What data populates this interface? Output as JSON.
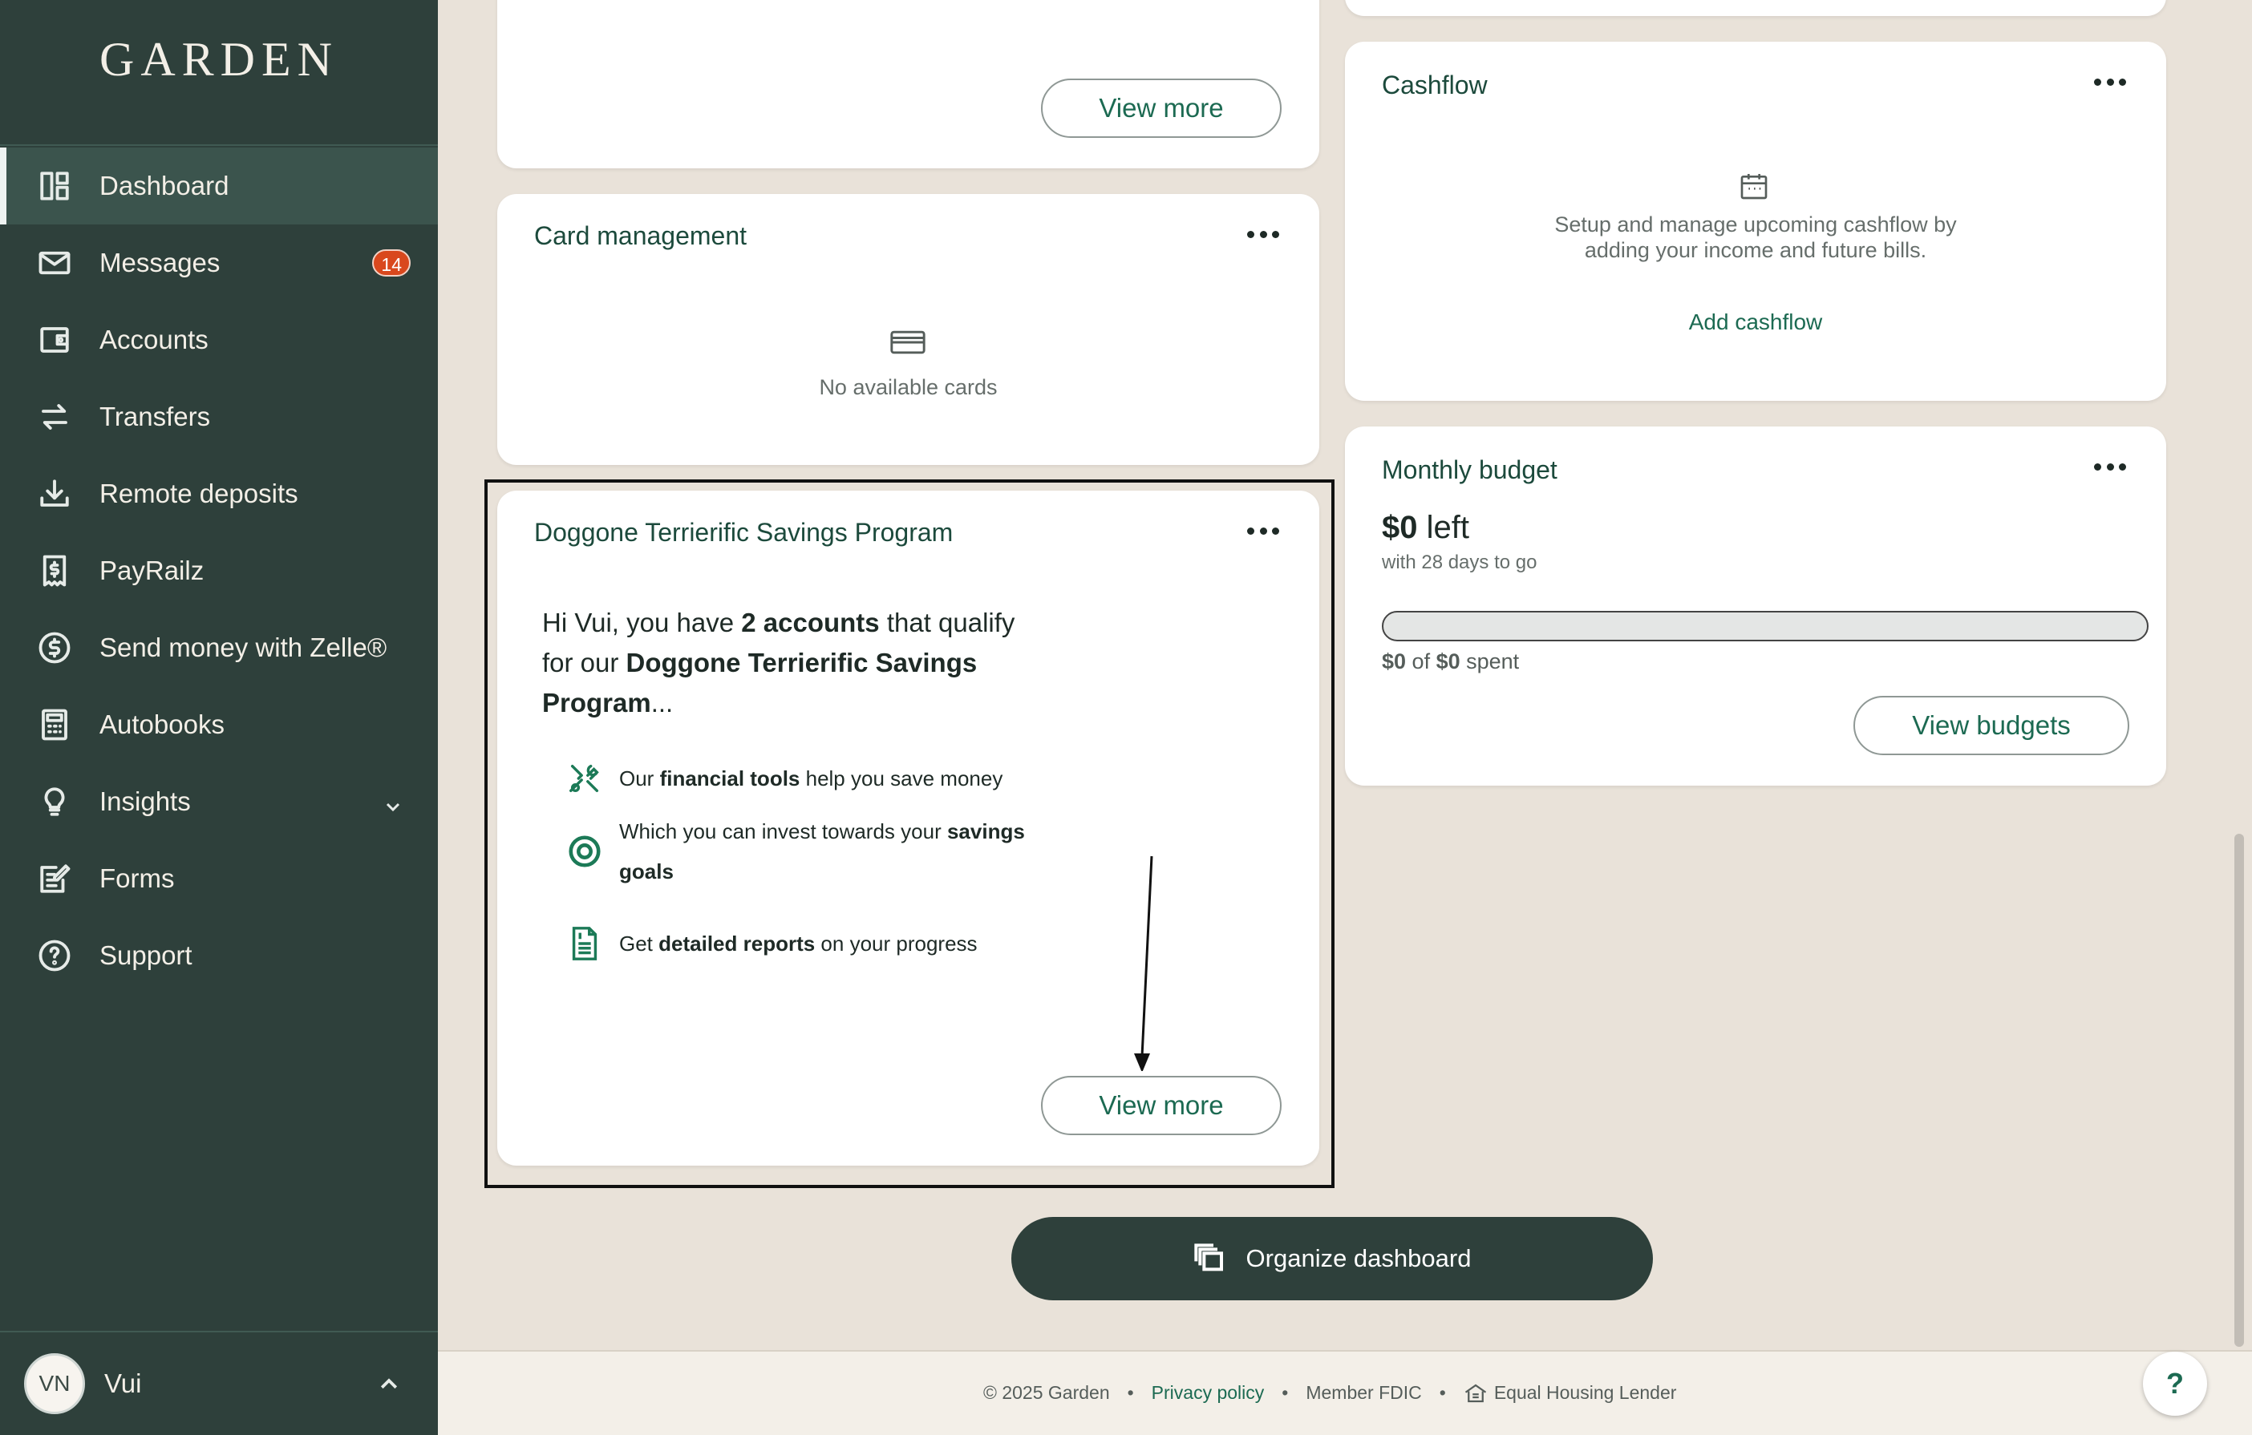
{
  "app": {
    "logo": "GARDEN"
  },
  "sidebar": {
    "items": [
      {
        "label": "Dashboard",
        "icon": "dashboard-icon",
        "active": true
      },
      {
        "label": "Messages",
        "icon": "envelope-icon",
        "badge": "14"
      },
      {
        "label": "Accounts",
        "icon": "wallet-icon"
      },
      {
        "label": "Transfers",
        "icon": "transfer-arrows-icon"
      },
      {
        "label": "Remote deposits",
        "icon": "download-icon"
      },
      {
        "label": "PayRailz",
        "icon": "dollar-receipt-icon"
      },
      {
        "label": "Send money with Zelle®",
        "icon": "dollar-circle-icon"
      },
      {
        "label": "Autobooks",
        "icon": "calculator-icon"
      },
      {
        "label": "Insights",
        "icon": "lightbulb-icon"
      },
      {
        "label": "Forms",
        "icon": "form-edit-icon"
      },
      {
        "label": "Support",
        "icon": "question-circle-icon"
      }
    ],
    "user": {
      "initials": "VN",
      "name": "Vui"
    }
  },
  "cards": {
    "top_left": {
      "button": "View more"
    },
    "card_management": {
      "title": "Card management",
      "empty_text": "No available cards"
    },
    "savings_program": {
      "title": "Doggone Terrierific Savings Program",
      "intro_1": "Hi Vui, you have ",
      "intro_bold_1": "2 accounts",
      "intro_2": " that qualify for our ",
      "intro_bold_2": "Doggone Terrierific Savings Program",
      "intro_3": "...",
      "features": [
        {
          "pre": "Our ",
          "bold": "financial tools",
          "post": " help you save money"
        },
        {
          "pre": "Which you can invest towards your ",
          "bold": "savings goals",
          "post": ""
        },
        {
          "pre": "Get ",
          "bold": "detailed reports",
          "post": " on your progress"
        }
      ],
      "button": "View more"
    },
    "cashflow": {
      "title": "Cashflow",
      "text": "Setup and manage upcoming cashflow by adding your income and future bills.",
      "link": "Add cashflow"
    },
    "monthly_budget": {
      "title": "Monthly budget",
      "amount": "$0",
      "amount_suffix": " left",
      "days": "with 28 days to go",
      "spent_amount": "$0",
      "spent_of": " of ",
      "spent_total": "$0",
      "spent_suffix": " spent",
      "progress_fraction": 0,
      "button": "View budgets"
    }
  },
  "organize_button": "Organize dashboard",
  "footer": {
    "copyright": "© 2025 Garden",
    "separator": "•",
    "privacy": "Privacy policy",
    "fdic": "Member FDIC",
    "housing": "Equal Housing Lender"
  },
  "help_button": "?"
}
